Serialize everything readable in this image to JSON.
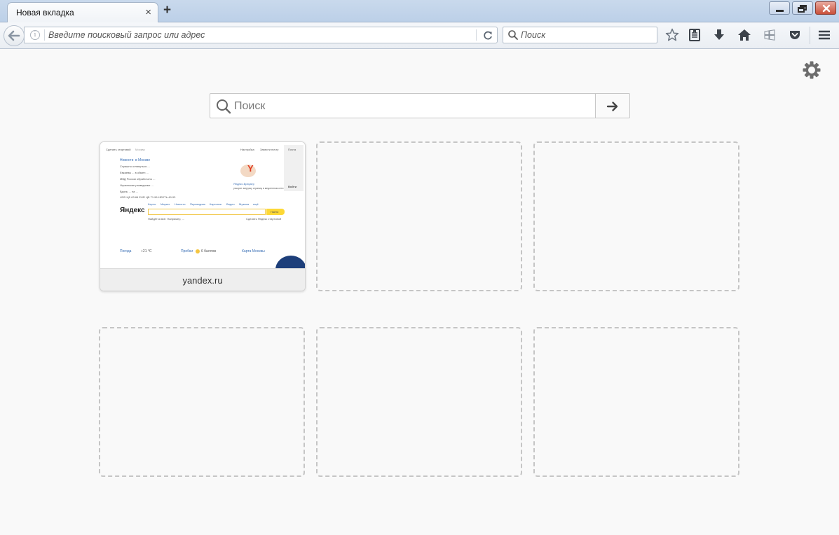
{
  "browser": {
    "tab_title": "Новая вкладка",
    "tab_close": "×",
    "new_tab": "+",
    "url_placeholder": "Введите поисковый запрос или адрес",
    "search_placeholder": "Поиск"
  },
  "newtab": {
    "search_placeholder": "Поиск",
    "tiles": [
      {
        "label": "yandex.ru"
      }
    ]
  },
  "thumbnail": {
    "top_left": "Сделать стартовой",
    "city": "Москва",
    "top_right_1": "Настройка",
    "top_right_2": "Завести почту",
    "top_right_3": "Почта",
    "news_header": "Новости",
    "news_city": "в Москве",
    "news": [
      "Страшно оглянуться ...",
      "Евкаевы ... в обмен ...",
      "МВД России обработало ...",
      "Украинские разведчики ...",
      "Вдоль ... на ..."
    ],
    "rates": "USD ЦБ 63.66  EUR ЦБ 71.96  НЕФТЬ 49.93",
    "browser_promo": "Яндекс.Браузер",
    "browser_promo_sub": "ускорит загрузку страниц в медленном сети",
    "logo": "Яндекс",
    "services": [
      "Карты",
      "Маркет",
      "Новости",
      "Переводчик",
      "Картинки",
      "Видео",
      "Музыка",
      "ещё"
    ],
    "find_btn": "Найти",
    "example": "Найдётся всё. Например, ...",
    "set_home": "Сделать Яндекс стартовой",
    "weather": "Погода",
    "temp": "+21 °C",
    "traffic": "Пробки",
    "traffic_val": "6 баллов",
    "metro_map": "Карта Москвы",
    "login": "Войти"
  }
}
